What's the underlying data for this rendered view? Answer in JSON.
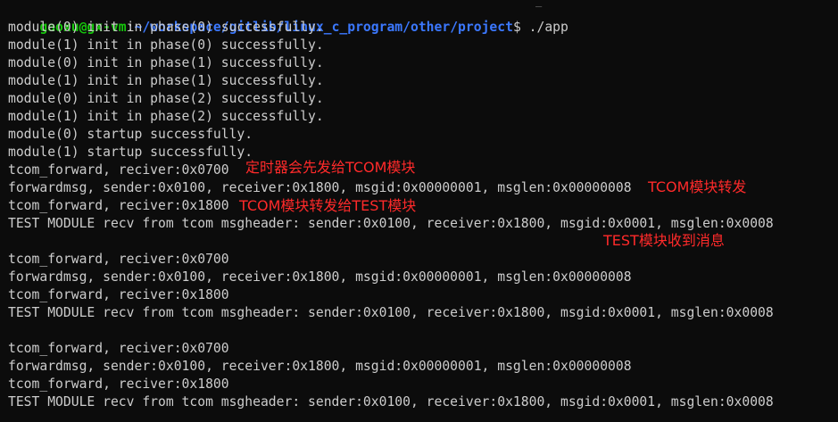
{
  "terminal": {
    "prompt_user": "gaoxu@gx-vm",
    "prompt_sep": ":",
    "prompt_path": "~/workspace/gitlib/linux_c_program/other/project",
    "prompt_symbol": "$",
    "command": " ./app",
    "lines": [
      "module(0) init in phase(0) successfully.",
      "module(1) init in phase(0) successfully.",
      "module(0) init in phase(1) successfully.",
      "module(1) init in phase(1) successfully.",
      "module(0) init in phase(2) successfully.",
      "module(1) init in phase(2) successfully.",
      "module(0) startup successfully.",
      "module(1) startup successfully.",
      "tcom_forward, reciver:0x0700",
      "forwardmsg, sender:0x0100, receiver:0x1800, msgid:0x00000001, msglen:0x00000008",
      "tcom_forward, reciver:0x1800",
      "TEST MODULE recv from tcom msgheader: sender:0x0100, receiver:0x1800, msgid:0x0001, msglen:0x0008",
      "",
      "tcom_forward, reciver:0x0700",
      "forwardmsg, sender:0x0100, receiver:0x1800, msgid:0x00000001, msglen:0x00000008",
      "tcom_forward, reciver:0x1800",
      "TEST MODULE recv from tcom msgheader: sender:0x0100, receiver:0x1800, msgid:0x0001, msglen:0x0008",
      "",
      "tcom_forward, reciver:0x0700",
      "forwardmsg, sender:0x0100, receiver:0x1800, msgid:0x00000001, msglen:0x00000008",
      "tcom_forward, reciver:0x1800",
      "TEST MODULE recv from tcom msgheader: sender:0x0100, receiver:0x1800, msgid:0x0001, msglen:0x0008"
    ]
  },
  "annotations": {
    "timer_to_tcom": "定时器会先发给TCOM模块",
    "tcom_forward": "TCOM模块转发",
    "tcom_to_test": "TCOM模块转发给TEST模块",
    "test_received": "TEST模块收到消息"
  },
  "colors": {
    "background": "#0c0c0c",
    "text": "#cccccc",
    "prompt_user": "#16c60c",
    "prompt_path": "#3b78ff",
    "annotation": "#ff2a2a"
  }
}
